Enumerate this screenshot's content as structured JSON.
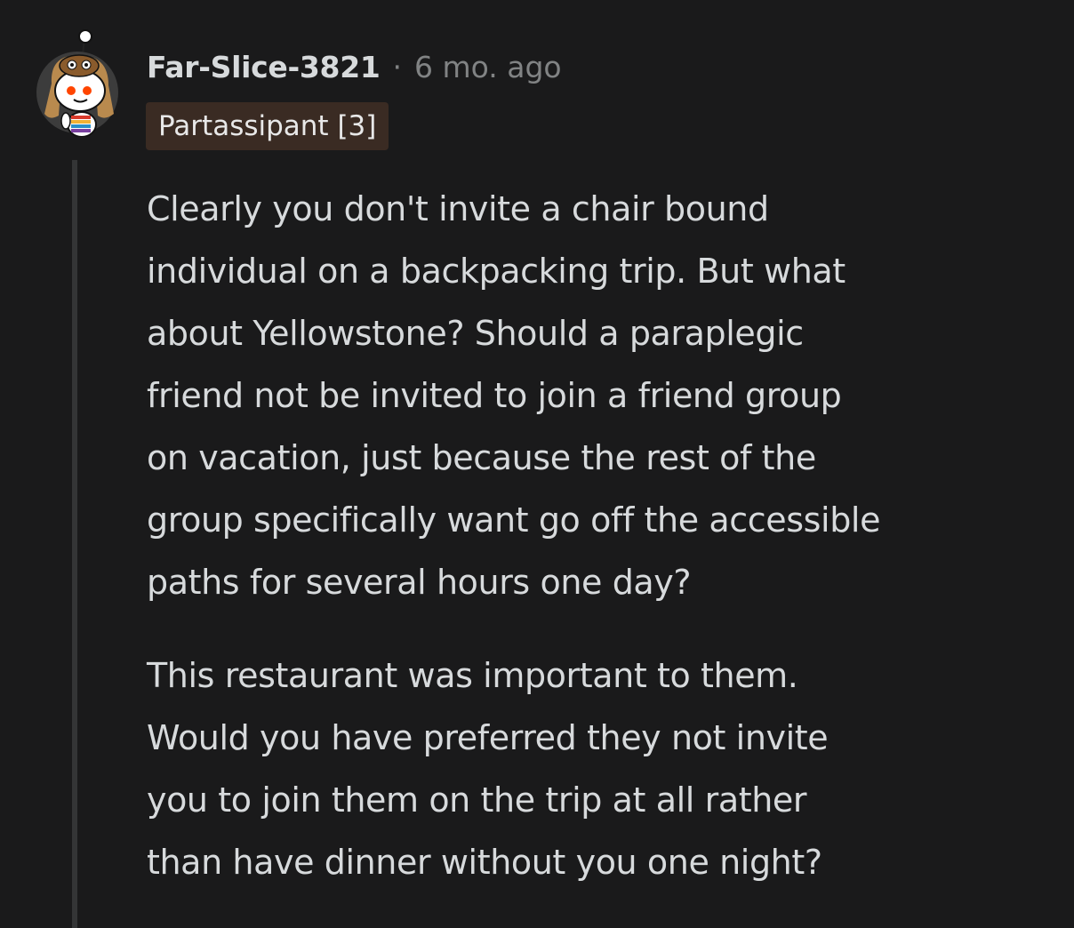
{
  "comment": {
    "author": "Far-Slice-3821",
    "separator": "·",
    "timestamp": "6 mo. ago",
    "flair": "Partassipant [3]",
    "avatar_icon": "snoo-avatar-icon",
    "flair_bg_color": "#3a2b23",
    "background_color": "#1a1a1b",
    "paragraphs": [
      "Clearly you don't invite a chair bound\nindividual on a backpacking trip. But what\nabout Yellowstone? Should a paraplegic\nfriend not be invited to join a friend group\non vacation, just because the rest of the\ngroup specifically want go off the accessible\npaths for several hours one day?",
      "This restaurant was important to them.\nWould you have preferred they not invite\nyou to join them on the trip at all rather\nthan have dinner without you one night?"
    ]
  }
}
